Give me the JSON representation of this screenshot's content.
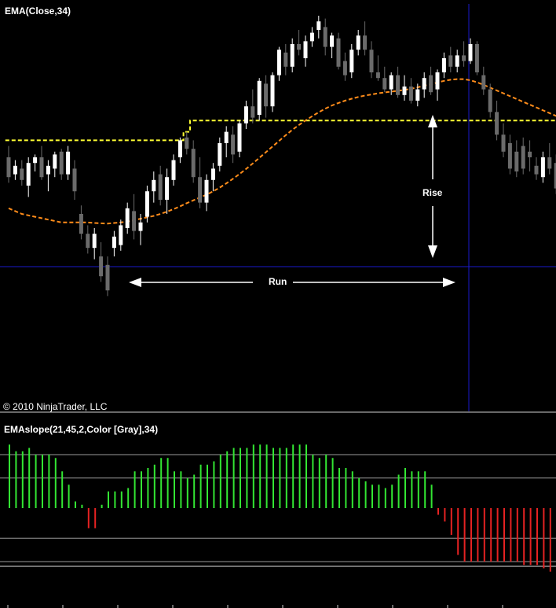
{
  "colors": {
    "background": "#000000",
    "up_candle": "#ffffff",
    "down_candle": "#6b6b6b",
    "ema_line": "#ff8c1a",
    "highest_line": "#ffff33",
    "crosshair": "#1a1acc",
    "slope_up": "#33e633",
    "slope_down": "#e62222",
    "grid": "#9a9a9a",
    "text": "#ffffff"
  },
  "chart_data": [
    {
      "type": "candlestick",
      "title": "EMA(Close,34)",
      "copyright": "© 2010 NinjaTrader, LLC",
      "annotations": {
        "rise": "Rise",
        "run": "Run"
      },
      "ylim": [
        0,
        100
      ],
      "candles": [
        {
          "o": 50,
          "h": 54,
          "l": 41,
          "c": 43
        },
        {
          "o": 44,
          "h": 49,
          "l": 42,
          "c": 47
        },
        {
          "o": 46,
          "h": 49,
          "l": 40,
          "c": 42
        },
        {
          "o": 40,
          "h": 50,
          "l": 36,
          "c": 48
        },
        {
          "o": 48,
          "h": 51,
          "l": 45,
          "c": 50
        },
        {
          "o": 50,
          "h": 54,
          "l": 42,
          "c": 43
        },
        {
          "o": 44,
          "h": 49,
          "l": 38,
          "c": 47
        },
        {
          "o": 46,
          "h": 52,
          "l": 43,
          "c": 51
        },
        {
          "o": 52,
          "h": 53,
          "l": 42,
          "c": 44
        },
        {
          "o": 44,
          "h": 54,
          "l": 42,
          "c": 52
        },
        {
          "o": 46,
          "h": 49,
          "l": 35,
          "c": 38
        },
        {
          "o": 30,
          "h": 33,
          "l": 21,
          "c": 23
        },
        {
          "o": 23,
          "h": 26,
          "l": 16,
          "c": 18
        },
        {
          "o": 18,
          "h": 25,
          "l": 14,
          "c": 23
        },
        {
          "o": 15,
          "h": 20,
          "l": 6,
          "c": 8
        },
        {
          "o": 12,
          "h": 15,
          "l": 1,
          "c": 3
        },
        {
          "o": 18,
          "h": 24,
          "l": 15,
          "c": 22
        },
        {
          "o": 19,
          "h": 28,
          "l": 17,
          "c": 26
        },
        {
          "o": 25,
          "h": 34,
          "l": 23,
          "c": 32
        },
        {
          "o": 31,
          "h": 37,
          "l": 21,
          "c": 24
        },
        {
          "o": 24,
          "h": 30,
          "l": 19,
          "c": 27
        },
        {
          "o": 29,
          "h": 40,
          "l": 27,
          "c": 38
        },
        {
          "o": 38,
          "h": 45,
          "l": 34,
          "c": 42
        },
        {
          "o": 44,
          "h": 47,
          "l": 33,
          "c": 35
        },
        {
          "o": 35,
          "h": 46,
          "l": 30,
          "c": 43
        },
        {
          "o": 42,
          "h": 51,
          "l": 40,
          "c": 49
        },
        {
          "o": 50,
          "h": 57,
          "l": 48,
          "c": 56
        },
        {
          "o": 57,
          "h": 59,
          "l": 51,
          "c": 53
        },
        {
          "o": 53,
          "h": 56,
          "l": 41,
          "c": 43
        },
        {
          "o": 43,
          "h": 50,
          "l": 32,
          "c": 34
        },
        {
          "o": 34,
          "h": 44,
          "l": 31,
          "c": 42
        },
        {
          "o": 42,
          "h": 48,
          "l": 38,
          "c": 46
        },
        {
          "o": 47,
          "h": 57,
          "l": 45,
          "c": 55
        },
        {
          "o": 55,
          "h": 61,
          "l": 50,
          "c": 59
        },
        {
          "o": 58,
          "h": 61,
          "l": 48,
          "c": 51
        },
        {
          "o": 52,
          "h": 63,
          "l": 50,
          "c": 62
        },
        {
          "o": 62,
          "h": 70,
          "l": 60,
          "c": 68
        },
        {
          "o": 68,
          "h": 74,
          "l": 62,
          "c": 64
        },
        {
          "o": 65,
          "h": 78,
          "l": 63,
          "c": 77
        },
        {
          "o": 76,
          "h": 79,
          "l": 64,
          "c": 68
        },
        {
          "o": 68,
          "h": 80,
          "l": 66,
          "c": 79
        },
        {
          "o": 79,
          "h": 89,
          "l": 77,
          "c": 88
        },
        {
          "o": 87,
          "h": 90,
          "l": 79,
          "c": 82
        },
        {
          "o": 82,
          "h": 92,
          "l": 80,
          "c": 90
        },
        {
          "o": 90,
          "h": 95,
          "l": 86,
          "c": 88
        },
        {
          "o": 85,
          "h": 93,
          "l": 82,
          "c": 91
        },
        {
          "o": 91,
          "h": 96,
          "l": 89,
          "c": 94
        },
        {
          "o": 95,
          "h": 100,
          "l": 92,
          "c": 98
        },
        {
          "o": 96,
          "h": 99,
          "l": 86,
          "c": 89
        },
        {
          "o": 89,
          "h": 94,
          "l": 85,
          "c": 93
        },
        {
          "o": 92,
          "h": 94,
          "l": 81,
          "c": 82
        },
        {
          "o": 84,
          "h": 87,
          "l": 77,
          "c": 79
        },
        {
          "o": 80,
          "h": 90,
          "l": 78,
          "c": 88
        },
        {
          "o": 88,
          "h": 95,
          "l": 86,
          "c": 93
        },
        {
          "o": 93,
          "h": 98,
          "l": 86,
          "c": 88
        },
        {
          "o": 88,
          "h": 91,
          "l": 78,
          "c": 80
        },
        {
          "o": 80,
          "h": 86,
          "l": 77,
          "c": 78
        },
        {
          "o": 78,
          "h": 82,
          "l": 73,
          "c": 74
        },
        {
          "o": 74,
          "h": 80,
          "l": 72,
          "c": 79
        },
        {
          "o": 79,
          "h": 82,
          "l": 71,
          "c": 72
        },
        {
          "o": 72,
          "h": 79,
          "l": 70,
          "c": 75
        },
        {
          "o": 75,
          "h": 78,
          "l": 69,
          "c": 70
        },
        {
          "o": 70,
          "h": 76,
          "l": 68,
          "c": 74
        },
        {
          "o": 74,
          "h": 80,
          "l": 71,
          "c": 78
        },
        {
          "o": 79,
          "h": 82,
          "l": 72,
          "c": 73
        },
        {
          "o": 74,
          "h": 81,
          "l": 70,
          "c": 80
        },
        {
          "o": 80,
          "h": 87,
          "l": 78,
          "c": 85
        },
        {
          "o": 86,
          "h": 89,
          "l": 80,
          "c": 82
        },
        {
          "o": 82,
          "h": 88,
          "l": 80,
          "c": 86
        },
        {
          "o": 86,
          "h": 91,
          "l": 82,
          "c": 84
        },
        {
          "o": 84,
          "h": 92,
          "l": 83,
          "c": 90
        },
        {
          "o": 90,
          "h": 91,
          "l": 79,
          "c": 80
        },
        {
          "o": 79,
          "h": 82,
          "l": 72,
          "c": 74
        },
        {
          "o": 74,
          "h": 76,
          "l": 64,
          "c": 66
        },
        {
          "o": 66,
          "h": 70,
          "l": 56,
          "c": 58
        },
        {
          "o": 58,
          "h": 62,
          "l": 50,
          "c": 52
        },
        {
          "o": 55,
          "h": 58,
          "l": 44,
          "c": 46
        },
        {
          "o": 52,
          "h": 56,
          "l": 43,
          "c": 45
        },
        {
          "o": 54,
          "h": 57,
          "l": 44,
          "c": 46
        },
        {
          "o": 52,
          "h": 56,
          "l": 45,
          "c": 50
        },
        {
          "o": 47,
          "h": 50,
          "l": 42,
          "c": 44
        },
        {
          "o": 43,
          "h": 52,
          "l": 41,
          "c": 50
        },
        {
          "o": 50,
          "h": 55,
          "l": 44,
          "c": 46
        },
        {
          "o": 48,
          "h": 51,
          "l": 37,
          "c": 39
        },
        {
          "o": 44,
          "h": 46,
          "l": 35,
          "c": 38
        },
        {
          "o": 37,
          "h": 39,
          "l": 29,
          "c": 31
        },
        {
          "o": 31,
          "h": 34,
          "l": 23,
          "c": 26
        }
      ],
      "ema": [
        32,
        31,
        30,
        29.5,
        29,
        28.5,
        28,
        27.5,
        27,
        27,
        27,
        27,
        27,
        26.8,
        26.7,
        26.6,
        26.8,
        27,
        27.3,
        27.8,
        28.3,
        28.8,
        29.3,
        30,
        30.8,
        31.7,
        32.7,
        33.8,
        34.8,
        35.8,
        36.8,
        38,
        39.3,
        40.8,
        42.4,
        44.1,
        45.9,
        47.8,
        49.8,
        51.8,
        53.8,
        55.8,
        57.8,
        59.7,
        61.4,
        63,
        64.5,
        65.9,
        67.2,
        68.3,
        69.2,
        70,
        70.7,
        71.3,
        71.8,
        72.2,
        72.6,
        72.9,
        73.2,
        73.5,
        73.8,
        74.2,
        74.7,
        75.3,
        75.8,
        76.4,
        77,
        77.4,
        77.6,
        77.6,
        77.2,
        76.5,
        75.6,
        74.6,
        73.6,
        72.6,
        71.6,
        70.6,
        69.6,
        68.6,
        67.6,
        66.6,
        65.6,
        64.6,
        63.6,
        62.6
      ],
      "highest": [
        56,
        56,
        56,
        56,
        56,
        56,
        56,
        56,
        56,
        56,
        56,
        56,
        56,
        56,
        56,
        56,
        56,
        56,
        56,
        56,
        56,
        56,
        56,
        56,
        56,
        56,
        56,
        59,
        63,
        63,
        63,
        63,
        63,
        63,
        63,
        63,
        63,
        63,
        63,
        63,
        63,
        63,
        63,
        63,
        63,
        63,
        63,
        63,
        63,
        63,
        63,
        63,
        63,
        63,
        63,
        63,
        63,
        63,
        63,
        63,
        63,
        63,
        63,
        63,
        63,
        63,
        63,
        63,
        63,
        63,
        63,
        63,
        63,
        63,
        63,
        63,
        63,
        63,
        63,
        63,
        63,
        63,
        63,
        63,
        63,
        63
      ],
      "price_levels": {
        "highest_start": 56
      }
    },
    {
      "type": "bar",
      "title": "EMAslope(21,45,2,Color [Gray],34)",
      "ylim": [
        -100,
        100
      ],
      "values": [
        95,
        85,
        85,
        90,
        80,
        80,
        80,
        75,
        55,
        35,
        10,
        5,
        -30,
        -30,
        5,
        25,
        25,
        25,
        30,
        55,
        55,
        60,
        65,
        75,
        75,
        55,
        55,
        45,
        50,
        65,
        65,
        70,
        80,
        85,
        90,
        90,
        90,
        95,
        95,
        95,
        90,
        90,
        90,
        95,
        95,
        95,
        80,
        75,
        80,
        75,
        60,
        60,
        55,
        45,
        40,
        35,
        35,
        30,
        35,
        50,
        60,
        55,
        55,
        55,
        35,
        -10,
        -20,
        -40,
        -70,
        -80,
        -80,
        -80,
        -80,
        -80,
        -80,
        -80,
        -80,
        -80,
        -85,
        -85,
        -85,
        -90,
        -95,
        -100
      ],
      "reference_levels": [
        80,
        45,
        -45,
        -80
      ]
    }
  ]
}
